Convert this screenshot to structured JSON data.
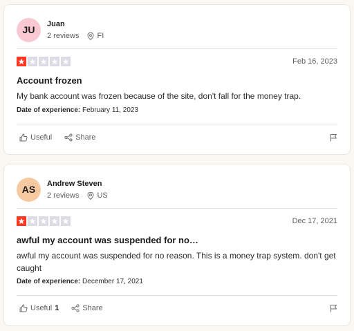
{
  "reviews": [
    {
      "initials": "JU",
      "avatar_color": "#f9c8d3",
      "name": "Juan",
      "review_count": "2 reviews",
      "location": "FI",
      "rating": 1,
      "date": "Feb 16, 2023",
      "title": "Account frozen",
      "body": "My bank account was frozen because of the site, don't fall for the money trap.",
      "experience_label": "Date of experience:",
      "experience_date": "February 11, 2023",
      "useful_label": "Useful",
      "useful_count": "",
      "share_label": "Share"
    },
    {
      "initials": "AS",
      "avatar_color": "#f7c9a1",
      "name": "Andrew Steven",
      "review_count": "2 reviews",
      "location": "US",
      "rating": 1,
      "date": "Dec 17, 2021",
      "title": "awful my account was suspended for no…",
      "body": "awful my account was suspended for no reason. This is a money trap system. don't get caught",
      "experience_label": "Date of experience:",
      "experience_date": "December 17, 2021",
      "useful_label": "Useful",
      "useful_count": "1",
      "share_label": "Share"
    }
  ],
  "colors": {
    "star_filled": "#ff3722",
    "star_empty": "#dcdce6",
    "background": "#fbf8f3"
  }
}
